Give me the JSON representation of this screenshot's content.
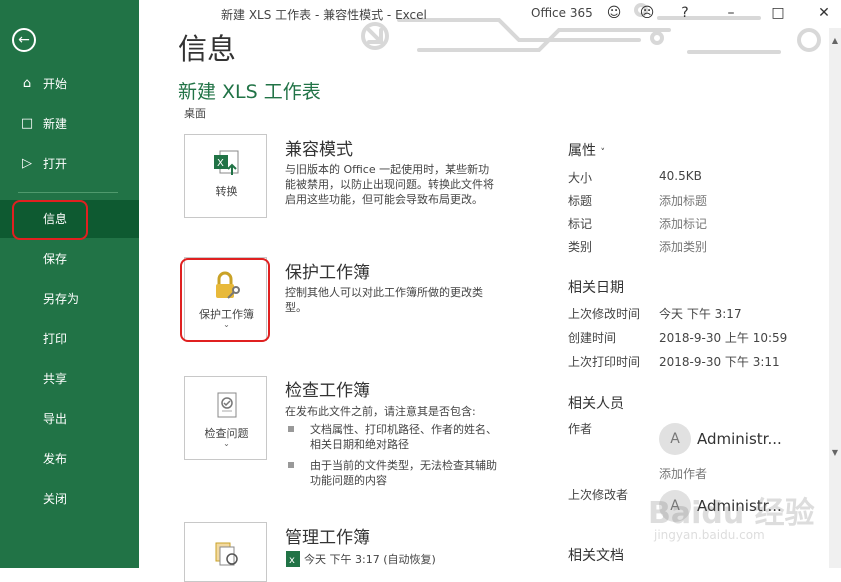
{
  "titlebar": {
    "title": "新建 XLS 工作表  -  兼容性模式  -  Excel",
    "office": "Office 365",
    "icons": [
      "smiley-icon",
      "frown-icon",
      "help-icon",
      "minimize-icon",
      "maximize-icon",
      "close-icon"
    ],
    "help": "?"
  },
  "sidebar": {
    "back_icon": "back-arrow-icon",
    "items": [
      {
        "label": "开始",
        "icon": "home-icon"
      },
      {
        "label": "新建",
        "icon": "new-doc-icon"
      },
      {
        "label": "打开",
        "icon": "folder-icon"
      },
      {
        "label": "信息"
      },
      {
        "label": "保存"
      },
      {
        "label": "另存为"
      },
      {
        "label": "打印"
      },
      {
        "label": "共享"
      },
      {
        "label": "导出"
      },
      {
        "label": "发布"
      },
      {
        "label": "关闭"
      }
    ],
    "active": "信息",
    "accent_color": "#217346"
  },
  "main": {
    "page_title": "信息",
    "file_title": "新建 XLS 工作表",
    "file_location": "桌面",
    "sections": {
      "compat": {
        "button": "转换",
        "heading": "兼容模式",
        "desc": "与旧版本的 Office 一起使用时，某些新功能被禁用，以防止出现问题。转换此文件将启用这些功能，但可能会导致布局更改。"
      },
      "protect": {
        "button": "保护工作簿",
        "heading": "保护工作簿",
        "desc": "控制其他人可以对此工作簿所做的更改类型。"
      },
      "inspect": {
        "button": "检查问题",
        "heading": "检查工作簿",
        "desc": "在发布此文件之前，请注意其是否包含:",
        "bullets": [
          "文档属性、打印机路径、作者的姓名、相关日期和绝对路径",
          "由于当前的文件类型，无法检查其辅助功能问题的内容"
        ]
      },
      "manage": {
        "heading": "管理工作簿",
        "version": "今天 下午 3:17 (自动恢复)"
      }
    }
  },
  "properties": {
    "heading": "属性",
    "rows": [
      {
        "label": "大小",
        "value": "40.5KB"
      },
      {
        "label": "标题",
        "value": "添加标题"
      },
      {
        "label": "标记",
        "value": "添加标记"
      },
      {
        "label": "类别",
        "value": "添加类别"
      }
    ],
    "dates_heading": "相关日期",
    "dates": [
      {
        "label": "上次修改时间",
        "value": "今天 下午 3:17"
      },
      {
        "label": "创建时间",
        "value": "2018-9-30 上午 10:59"
      },
      {
        "label": "上次打印时间",
        "value": "2018-9-30 下午 3:11"
      }
    ],
    "people_heading": "相关人员",
    "author_label": "作者",
    "author_name": "Administr...",
    "avatar_letter": "A",
    "add_author": "添加作者",
    "last_modified_by_label": "上次修改者",
    "last_modified_by": "Administr...",
    "docs_heading": "相关文档"
  },
  "watermark": {
    "text": "Baidu 经验",
    "url": "jingyan.baidu.com"
  }
}
